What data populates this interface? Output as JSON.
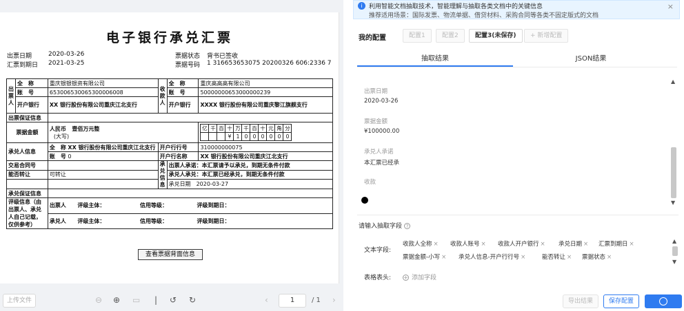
{
  "document": {
    "title": "电子银行承兑汇票",
    "issue_date_label": "出票日期",
    "issue_date": "2020-03-26",
    "due_date_label": "汇票到期日",
    "due_date": "2021-03-25",
    "status_label": "票据状态",
    "status_value": "背书已签收",
    "bill_no_label": "票据号码",
    "bill_no": "1 316653653075 20200326 606:2336 7",
    "drawer_header": "出票人",
    "payee_header": "收款人",
    "full_name_label": "全　称",
    "account_label": "账　号",
    "bank_label": "开户银行",
    "drawer_name": "重庆银银银资有限公司",
    "drawer_account": "653006530065300006008",
    "drawer_bank": "XX 银行股份有限公司重庆江北支行",
    "payee_name": "重庆高高高有限公司",
    "payee_account": "50000000653000000239",
    "payee_bank": "XXXX 银行股份有限公司重庆黎江旗舰支行",
    "guarantee_label": "出票保证信息",
    "amount_label": "票据金额",
    "amount_currency": "人民币",
    "amount_currency_sub": "(大写)",
    "amount_words": "壹佰万元整",
    "digit_headers": [
      "亿",
      "千",
      "百",
      "十",
      "万",
      "千",
      "百",
      "十",
      "元",
      "角",
      "分"
    ],
    "digit_values": [
      "",
      "",
      "",
      "¥",
      "1",
      "0",
      "0",
      "0",
      "0",
      "0",
      "0"
    ],
    "acceptor_label": "承兑人信息",
    "acceptor_full_name_label": "全　称",
    "acceptor_name": "XX 银行股份有限公司重庆江北支行",
    "acceptor_account_label": "账　号",
    "acceptor_account": "0",
    "bank_no_label": "开户行行号",
    "bank_no": "310000000075",
    "bank_name_label": "开户行名称",
    "bank_name": "XX 银行股份有限公司重庆江北支行",
    "contract_label": "交易合同号",
    "transfer_label": "能否转让",
    "transfer_value": "可转让",
    "accept_info_label": "承兑信息",
    "drawer_promise": "出票人承诺：本汇票请予以承兑，到期无条件付款",
    "acceptor_promise": "承兑人承兑：本汇票已经承兑，到期无条件付款",
    "accept_date": "承兑日期　2020-03-27",
    "acceptor_guarantee_label": "承兑保证信息",
    "rating_label": "评级信息（由出票人、承兑人自己记载，仅供参考）",
    "rating_drawer": "出票人",
    "rating_acceptor": "承兑人",
    "rating_subject": "评级主体：",
    "rating_level": "信用等级：",
    "rating_due": "评级到期日：",
    "back_button": "查看票据背面信息"
  },
  "viewer": {
    "upload_button": "上传文件",
    "page_current": "1",
    "page_total": "/ 1"
  },
  "tip": {
    "line1": "利用智能文档抽取技术，智能理解与抽取各类文档中的关键信息",
    "line2": "推荐适用场景：国际发票、物流单据、借贷材料、采购合同等各类不固定版式的文档"
  },
  "config": {
    "label": "我的配置",
    "tabs": [
      "配置1",
      "配置2",
      "配置3(未保存)",
      "+ 新增配置"
    ]
  },
  "result_tabs": [
    "抽取结果",
    "JSON结果"
  ],
  "results": [
    {
      "label": "出票日期",
      "value": "2020-03-26"
    },
    {
      "label": "票据金额",
      "value": "¥100000.00"
    },
    {
      "label": "承兑人承诺",
      "value": "本汇票已经承"
    },
    {
      "label": "收款",
      "value": ""
    }
  ],
  "fields": {
    "title": "请输入抽取字段",
    "text_label": "文本字段:",
    "chips": [
      "收款人全称",
      "收款人账号",
      "收款人开户银行",
      "承兑日期",
      "汇票到期日",
      "票据金额-小写",
      "承兑人信息-开户行行号",
      "能否转让",
      "票据状态"
    ],
    "table_label": "表格表头:",
    "add_field": "添加字段"
  },
  "actions": {
    "export": "导出结果",
    "save": "保存配置"
  }
}
